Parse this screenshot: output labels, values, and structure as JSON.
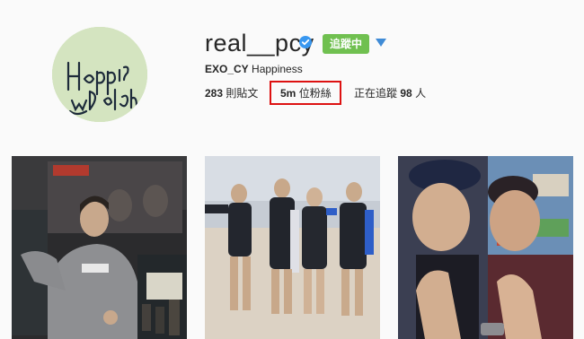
{
  "profile": {
    "username": "real__pcy",
    "verified": true,
    "follow_button": "追蹤中",
    "bio_name": "EXO_CY",
    "bio_text": "Happiness",
    "avatar_text": "Happiness Delight",
    "stats": {
      "posts_count": "283",
      "posts_label": "則貼文",
      "followers_count": "5m",
      "followers_label": "位粉絲",
      "following_label": "正在追蹤",
      "following_count": "98",
      "following_unit": "人"
    }
  },
  "colors": {
    "follow_green": "#70c050",
    "verified_blue": "#3897f0",
    "highlight_red": "#d11111",
    "dropdown_blue": "#3f8bd6"
  },
  "photos": [
    {
      "description_icon": "photo-thumbnail"
    },
    {
      "description_icon": "photo-thumbnail"
    },
    {
      "description_icon": "photo-thumbnail"
    }
  ]
}
